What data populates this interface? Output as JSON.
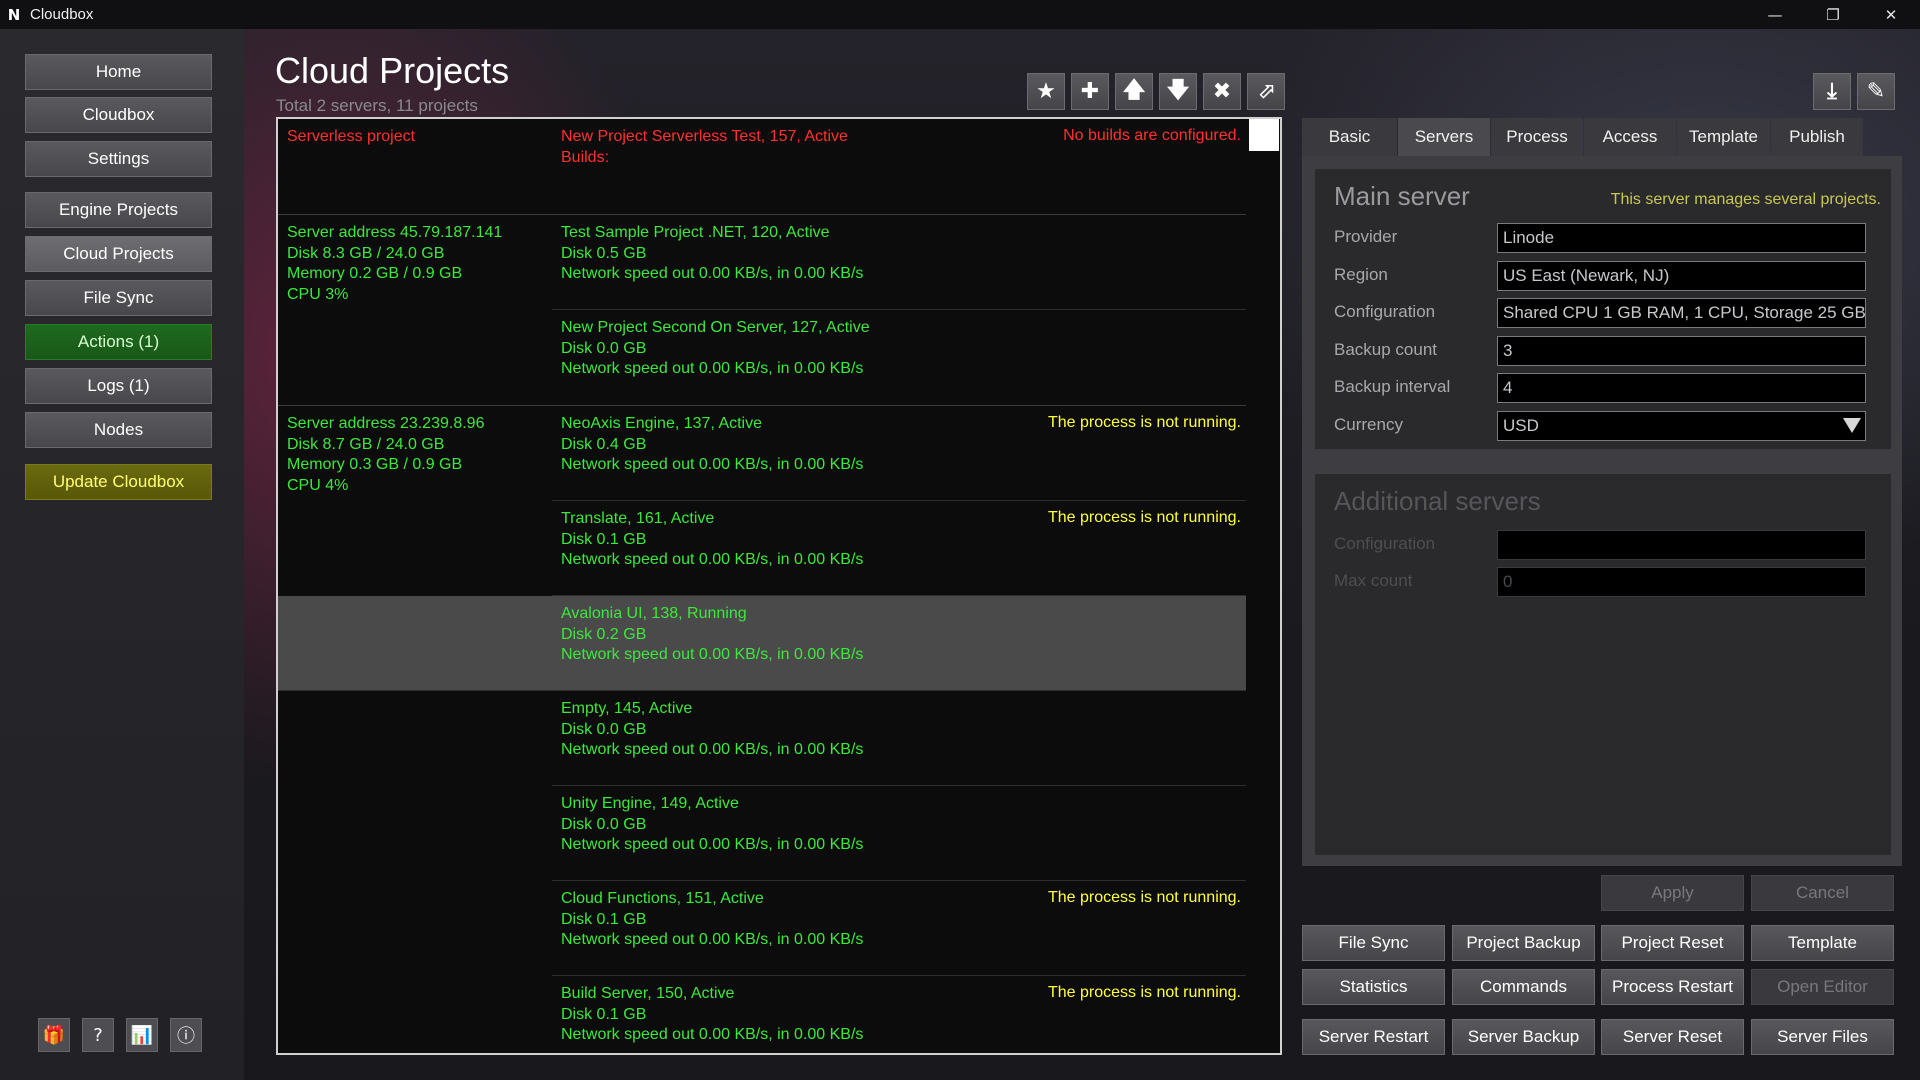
{
  "window": {
    "title": "Cloudbox",
    "logo": "N"
  },
  "sidebar": {
    "items": [
      {
        "label": "Home"
      },
      {
        "label": "Cloudbox"
      },
      {
        "label": "Settings"
      },
      {
        "label": "Engine Projects"
      },
      {
        "label": "Cloud Projects"
      },
      {
        "label": "File Sync"
      },
      {
        "label": "Actions (1)"
      },
      {
        "label": "Logs (1)"
      },
      {
        "label": "Nodes"
      },
      {
        "label": "Update Cloudbox"
      }
    ],
    "bottom_icons": [
      "gift-icon",
      "help-icon",
      "stats-icon",
      "info-icon"
    ]
  },
  "header": {
    "title": "Cloud Projects",
    "subtitle": "Total 2 servers, 11 projects"
  },
  "toolbar": [
    "star-icon",
    "plus-icon",
    "arrow-up-icon",
    "arrow-down-icon",
    "close-icon",
    "open-external-icon"
  ],
  "toolbar_right": [
    "download-icon",
    "edit-icon"
  ],
  "groups": [
    {
      "server": [
        "Serverless project"
      ],
      "red": true,
      "projects": [
        {
          "lines": [
            "New Project Serverless Test, 157, Active",
            "Builds:"
          ],
          "status": "No builds are configured.",
          "red": true
        }
      ]
    },
    {
      "server": [
        "Server address 45.79.187.141",
        "Disk 8.3 GB / 24.0 GB",
        "Memory 0.2 GB / 0.9 GB",
        "CPU 3%"
      ],
      "projects": [
        {
          "lines": [
            "Test Sample Project .NET, 120, Active",
            "Disk 0.5 GB",
            "Network speed out 0.00 KB/s, in 0.00 KB/s"
          ],
          "status": ""
        },
        {
          "lines": [
            "New Project Second On Server, 127, Active",
            "Disk 0.0 GB",
            "Network speed out 0.00 KB/s, in 0.00 KB/s"
          ],
          "status": ""
        }
      ]
    },
    {
      "server": [
        "Server address 23.239.8.96",
        "Disk 8.7 GB / 24.0 GB",
        "Memory 0.3 GB / 0.9 GB",
        "CPU 4%"
      ],
      "projects": [
        {
          "lines": [
            "NeoAxis Engine, 137, Active",
            "Disk 0.4 GB",
            "Network speed out 0.00 KB/s, in 0.00 KB/s"
          ],
          "status": "The process is not running."
        },
        {
          "lines": [
            "Translate, 161, Active",
            "Disk 0.1 GB",
            "Network speed out 0.00 KB/s, in 0.00 KB/s"
          ],
          "status": "The process is not running."
        },
        {
          "lines": [
            "Avalonia UI, 138, Running",
            "Disk 0.2 GB",
            "Network speed out 0.00 KB/s, in 0.00 KB/s"
          ],
          "status": "",
          "selected": true
        },
        {
          "lines": [
            "Empty, 145, Active",
            "Disk 0.0 GB",
            "Network speed out 0.00 KB/s, in 0.00 KB/s"
          ],
          "status": ""
        },
        {
          "lines": [
            "Unity Engine, 149, Active",
            "Disk 0.0 GB",
            "Network speed out 0.00 KB/s, in 0.00 KB/s"
          ],
          "status": ""
        },
        {
          "lines": [
            "Cloud Functions, 151, Active",
            "Disk 0.1 GB",
            "Network speed out 0.00 KB/s, in 0.00 KB/s"
          ],
          "status": "The process is not running."
        },
        {
          "lines": [
            "Build Server, 150, Active",
            "Disk 0.1 GB",
            "Network speed out 0.00 KB/s, in 0.00 KB/s"
          ],
          "status": "The process is not running."
        }
      ]
    }
  ],
  "tabs": [
    {
      "label": "Basic"
    },
    {
      "label": "Servers",
      "active": true
    },
    {
      "label": "Process"
    },
    {
      "label": "Access"
    },
    {
      "label": "Template"
    },
    {
      "label": "Publish"
    }
  ],
  "main_server": {
    "title": "Main server",
    "note": "This server manages several projects.",
    "fields": [
      {
        "label": "Provider",
        "value": "Linode"
      },
      {
        "label": "Region",
        "value": "US East (Newark, NJ)"
      },
      {
        "label": "Configuration",
        "value": "Shared CPU 1 GB RAM, 1 CPU, Storage 25 GB"
      },
      {
        "label": "Backup count",
        "value": "3"
      },
      {
        "label": "Backup interval",
        "value": "4"
      },
      {
        "label": "Currency",
        "value": "USD",
        "select": true
      }
    ]
  },
  "additional_servers": {
    "title": "Additional servers",
    "fields": [
      {
        "label": "Configuration",
        "value": ""
      },
      {
        "label": "Max count",
        "value": "0"
      }
    ]
  },
  "form_buttons": {
    "apply": "Apply",
    "cancel": "Cancel"
  },
  "action_buttons": [
    {
      "label": "File Sync"
    },
    {
      "label": "Project Backup"
    },
    {
      "label": "Project Reset"
    },
    {
      "label": "Template"
    },
    {
      "label": "Statistics"
    },
    {
      "label": "Commands"
    },
    {
      "label": "Process Restart"
    },
    {
      "label": "Open Editor",
      "disabled": true
    },
    {
      "label": "Server Restart"
    },
    {
      "label": "Server Backup"
    },
    {
      "label": "Server Reset"
    },
    {
      "label": "Server Files"
    }
  ],
  "colors": {
    "ok_text": "#3ce83c",
    "error_text": "#ff3030",
    "warning_text": "#ffff40",
    "note_text": "#c8c850"
  }
}
